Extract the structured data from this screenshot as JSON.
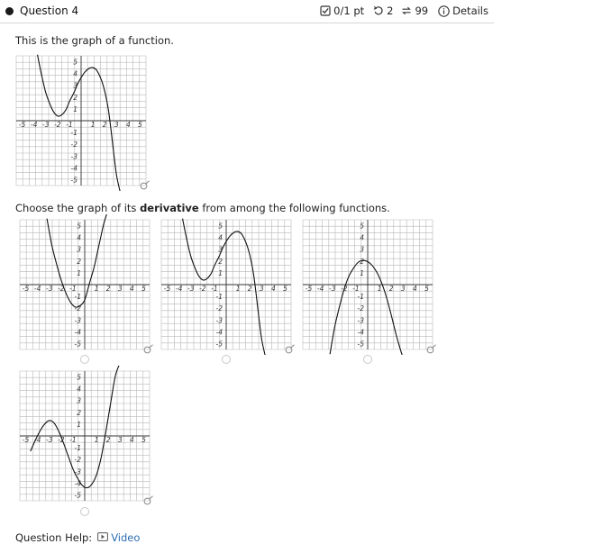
{
  "header": {
    "title": "Question 4",
    "score": "0/1 pt",
    "retries": "2",
    "attempts": "99",
    "details": "Details"
  },
  "prompt": {
    "intro": "This is the graph of a function.",
    "choose_pre": "Choose the graph of its ",
    "choose_bold": "derivative",
    "choose_post": " from among the following functions."
  },
  "help": {
    "label": "Question Help:",
    "video": "Video"
  },
  "colors": {
    "grid": "#b8b8b8",
    "axis": "#333333",
    "curve": "#111111",
    "link": "#2c6db3"
  },
  "chart_data": [
    {
      "type": "line",
      "role": "given-function",
      "x_ticks": [
        "-5",
        "-4",
        "-3",
        "-2",
        "-1",
        "1",
        "2",
        "3",
        "4",
        "5"
      ],
      "y_ticks": [
        "5",
        "4",
        "3",
        "2",
        "1",
        "-1",
        "-2",
        "-3",
        "-4",
        "-5"
      ],
      "xlim": [
        -5,
        5
      ],
      "ylim": [
        -5,
        5
      ],
      "grid": true,
      "series": [
        {
          "x": [
            -3.7,
            -3.4,
            -3,
            -2.6,
            -2.3,
            -2,
            -1.7,
            -1.3,
            -1,
            -0.6,
            -0.2,
            0.3,
            0.7,
            1,
            1.3,
            1.7,
            2,
            2.3,
            2.5,
            2.7,
            3,
            3.3
          ],
          "y": [
            5.6,
            4.1,
            2.4,
            1.3,
            0.7,
            0.4,
            0.45,
            0.9,
            1.6,
            2.4,
            3.3,
            4.1,
            4.45,
            4.5,
            4.3,
            3.5,
            2.5,
            1,
            -0.5,
            -2.2,
            -4.6,
            -6
          ]
        }
      ]
    },
    {
      "type": "line",
      "role": "choice-a",
      "x_ticks": [
        "-5",
        "-4",
        "-3",
        "-2",
        "-1",
        "1",
        "2",
        "3",
        "4",
        "5"
      ],
      "y_ticks": [
        "5",
        "4",
        "3",
        "2",
        "1",
        "-1",
        "-2",
        "-3",
        "-4",
        "-5"
      ],
      "xlim": [
        -5,
        5
      ],
      "ylim": [
        -5,
        5
      ],
      "grid": true,
      "series": [
        {
          "x": [
            -3.2,
            -2.8,
            -2.4,
            -2,
            -1.6,
            -1.2,
            -0.8,
            -0.4,
            0,
            0.4,
            0.8,
            1.2,
            1.6,
            1.9
          ],
          "y": [
            5.6,
            3.4,
            1.8,
            0.4,
            -0.7,
            -1.5,
            -1.9,
            -1.8,
            -1.3,
            0.1,
            1.5,
            3.3,
            5.1,
            6.1
          ]
        }
      ]
    },
    {
      "type": "line",
      "role": "choice-b",
      "x_ticks": [
        "-5",
        "-4",
        "-3",
        "-2",
        "-1",
        "1",
        "2",
        "3",
        "4",
        "5"
      ],
      "y_ticks": [
        "5",
        "4",
        "3",
        "2",
        "1",
        "-1",
        "-2",
        "-3",
        "-4",
        "-5"
      ],
      "xlim": [
        -5,
        5
      ],
      "ylim": [
        -5,
        5
      ],
      "grid": true,
      "series": [
        {
          "x": [
            -3.7,
            -3.4,
            -3,
            -2.6,
            -2.3,
            -2,
            -1.7,
            -1.3,
            -1,
            -0.6,
            -0.2,
            0.3,
            0.7,
            1,
            1.3,
            1.7,
            2,
            2.3,
            2.5,
            2.7,
            3,
            3.3
          ],
          "y": [
            5.6,
            4.1,
            2.4,
            1.3,
            0.7,
            0.4,
            0.45,
            0.9,
            1.6,
            2.4,
            3.3,
            4.1,
            4.45,
            4.5,
            4.3,
            3.5,
            2.5,
            1,
            -0.5,
            -2.2,
            -4.6,
            -6
          ]
        }
      ]
    },
    {
      "type": "line",
      "role": "choice-c",
      "x_ticks": [
        "-5",
        "-4",
        "-3",
        "-2",
        "-1",
        "1",
        "2",
        "3",
        "4",
        "5"
      ],
      "y_ticks": [
        "5",
        "4",
        "3",
        "2",
        "1",
        "-1",
        "-2",
        "-3",
        "-4",
        "-5"
      ],
      "xlim": [
        -5,
        5
      ],
      "ylim": [
        -5,
        5
      ],
      "grid": true,
      "series": [
        {
          "x": [
            -3.2,
            -2.8,
            -2.4,
            -2,
            -1.6,
            -1.2,
            -0.8,
            -0.4,
            0,
            0.4,
            0.8,
            1.2,
            1.6,
            2,
            2.4,
            2.8,
            3.2
          ],
          "y": [
            -5.9,
            -3.6,
            -1.9,
            -0.4,
            0.7,
            1.4,
            1.9,
            2.05,
            1.95,
            1.6,
            1,
            0.1,
            -1.1,
            -2.6,
            -4.2,
            -5.6,
            -6.8
          ]
        }
      ]
    },
    {
      "type": "line",
      "role": "choice-d",
      "x_ticks": [
        "-5",
        "-4",
        "-3",
        "-2",
        "-1",
        "1",
        "2",
        "3",
        "4",
        "5"
      ],
      "y_ticks": [
        "5",
        "4",
        "3",
        "2",
        "1",
        "-1",
        "-2",
        "-3",
        "-4",
        "-5"
      ],
      "xlim": [
        -5,
        5
      ],
      "ylim": [
        -5,
        5
      ],
      "grid": true,
      "series": [
        {
          "x": [
            -4.6,
            -4.2,
            -3.8,
            -3.4,
            -3,
            -2.6,
            -2.2,
            -1.8,
            -1.4,
            -1,
            -0.6,
            -0.2,
            0.2,
            0.6,
            1,
            1.4,
            1.8,
            2.2,
            2.6,
            3
          ],
          "y": [
            -1.3,
            -0.4,
            0.4,
            1,
            1.3,
            1.1,
            0.4,
            -0.6,
            -1.7,
            -2.8,
            -3.6,
            -4.2,
            -4.4,
            -4.1,
            -3.3,
            -1.8,
            0.4,
            2.8,
            5.1,
            6.2
          ]
        }
      ]
    }
  ]
}
